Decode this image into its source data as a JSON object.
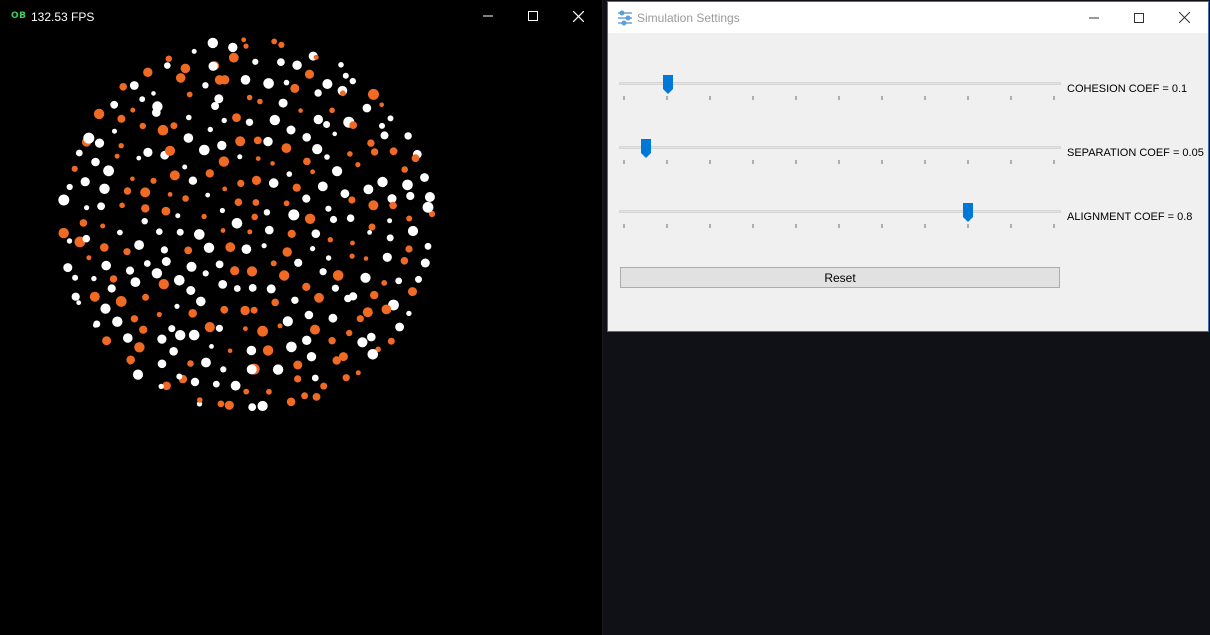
{
  "sim_window": {
    "badge": "OB",
    "fps": "132.53 FPS",
    "colors": {
      "background": "#000000",
      "orange": "#f06a24",
      "white": "#ffffff"
    }
  },
  "settings_window": {
    "title": "Simulation Settings",
    "sliders": [
      {
        "label": "COHESION COEF = 0.1",
        "value": 0.11
      },
      {
        "label": "SEPARATION COEF = 0.05",
        "value": 0.06
      },
      {
        "label": "ALIGNMENT COEF = 0.8",
        "value": 0.79
      }
    ],
    "reset_label": "Reset",
    "accent": "#0078d7"
  },
  "icons": {
    "minimize": "minimize-icon",
    "maximize": "maximize-icon",
    "close": "close-icon",
    "settings": "sliders-icon"
  }
}
